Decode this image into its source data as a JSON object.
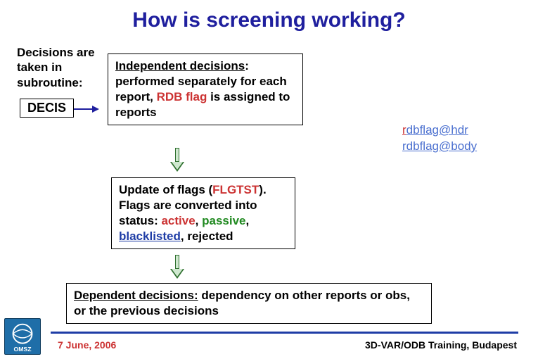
{
  "title": "How is screening working?",
  "intro": "Decisions are taken in subroutine:",
  "decisLabel": "DECIS",
  "box1": {
    "lead": "Independent decisions",
    "after_lead": ": performed separately for each report, ",
    "rdb": "RDB flag",
    "tail": " is assigned to reports"
  },
  "box2": {
    "t1": "Update of flags (",
    "flgtst": "FLGTST",
    "t2": "). Flags are converted into status: ",
    "active": "active",
    "sep": ", ",
    "passive": "passive",
    "blacklisted": "blacklisted",
    "rejected": "rejected"
  },
  "box3": {
    "lead": "Dependent decisions:",
    "rest": " dependency on other reports or obs, or the previous decisions"
  },
  "links": {
    "l1_r": "r",
    "l1_rest": "dbflag@hdr",
    "l2": "rdbflag@body"
  },
  "footer": {
    "left": "7 June, 2006",
    "right": "3D-VAR/ODB Training, Budapest"
  }
}
